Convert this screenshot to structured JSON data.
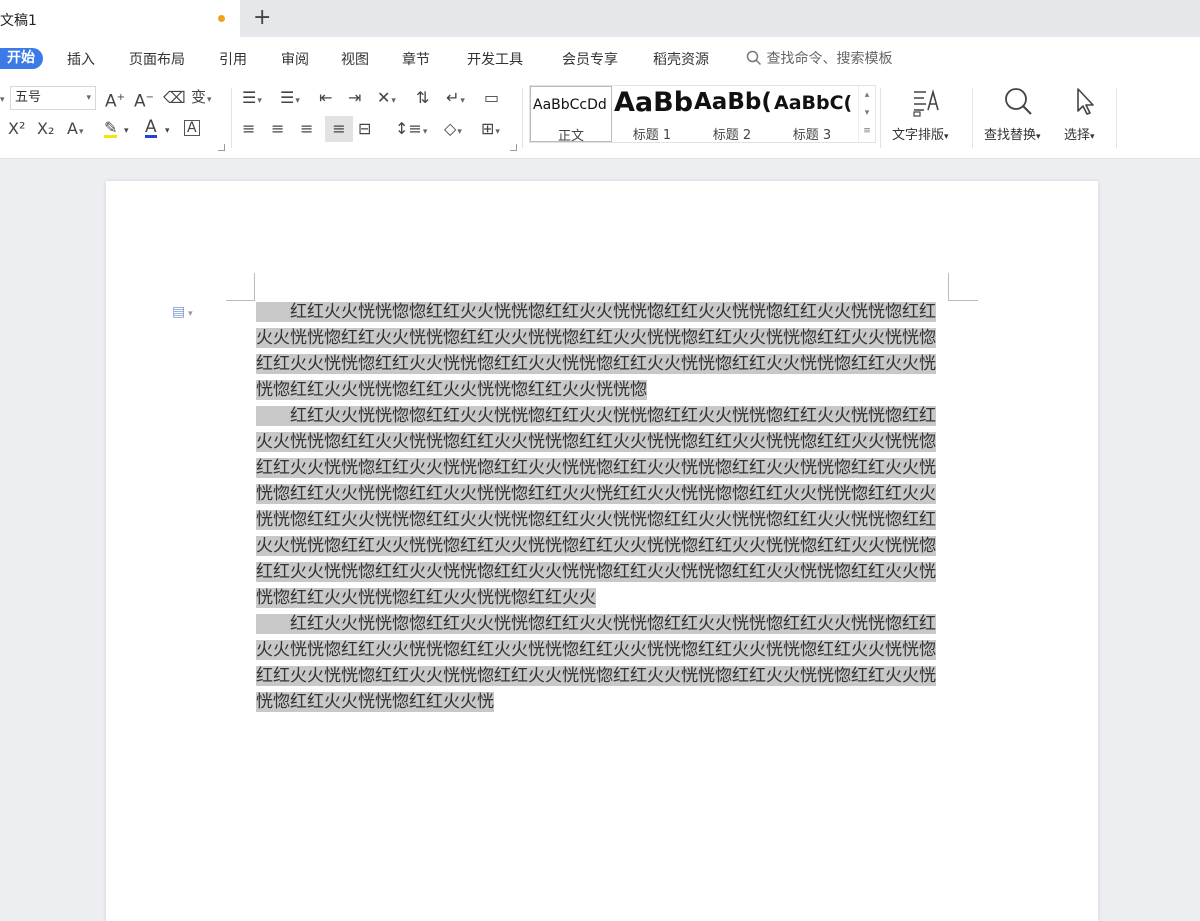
{
  "doc_tab": {
    "title": "文稿1",
    "new_tab": "+"
  },
  "menu": {
    "items": [
      "开始",
      "插入",
      "页面布局",
      "引用",
      "审阅",
      "视图",
      "章节",
      "开发工具",
      "会员专享",
      "稻壳资源"
    ],
    "search_placeholder": "查找命令、搜索模板"
  },
  "ribbon": {
    "font_size": "五号",
    "styles": [
      {
        "sample": "AaBbCcDd",
        "name": "正文"
      },
      {
        "sample": "AaBb",
        "name": "标题 1"
      },
      {
        "sample": "AaBb(",
        "name": "标题 2"
      },
      {
        "sample": "AaBbC(",
        "name": "标题 3"
      }
    ],
    "text_layout": "文字排版",
    "find_replace": "查找替换",
    "select": "选择"
  },
  "document": {
    "paragraphs": [
      "红红火火恍恍惚惚红红火火恍恍惚红红火火恍恍惚红红火火恍恍惚红红火火恍恍惚红红火火恍恍惚红红火火恍恍惚红红火火恍恍惚红红火火恍恍惚红红火火恍恍惚红红火火恍恍惚红红火火恍恍惚红红火火恍恍惚红红火火恍恍惚红红火火恍恍惚红红火火恍恍惚红红火火恍恍惚红红火火恍恍惚红红火火恍恍惚红红火火恍恍惚",
      "红红火火恍恍惚惚红红火火恍恍惚红红火火恍恍惚红红火火恍恍惚红红火火恍恍惚红红火火恍恍惚红红火火恍恍惚红红火火恍恍惚红红火火恍恍惚红红火火恍恍惚红红火火恍恍惚红红火火恍恍惚红红火火恍恍惚红红火火恍恍惚红红火火恍恍惚红红火火恍恍惚红红火火恍恍惚红红火火恍恍惚红红火火恍恍惚红红火火恍红红火火恍恍惚惚红红火火恍恍惚红红火火恍恍惚红红火火恍恍惚红红火火恍恍惚红红火火恍恍惚红红火火恍恍惚红红火火恍恍惚红红火火恍恍惚红红火火恍恍惚红红火火恍恍惚红红火火恍恍惚红红火火恍恍惚红红火火恍恍惚红红火火恍恍惚红红火火恍恍惚红红火火恍恍惚红红火火恍恍惚红红火火恍恍惚红红火火恍恍惚红红火火恍恍惚红红火火恍恍惚红红火火",
      "红红火火恍恍惚惚红红火火恍恍惚红红火火恍恍惚红红火火恍恍惚红红火火恍恍惚红红火火恍恍惚红红火火恍恍惚红红火火恍恍惚红红火火恍恍惚红红火火恍恍惚红红火火恍恍惚红红火火恍恍惚红红火火恍恍惚红红火火恍恍惚红红火火恍恍惚红红火火恍恍惚红红火火恍恍惚红红火火恍恍惚红红火火恍"
    ]
  },
  "colors": {
    "accent": "#3b7be8",
    "selection": "#c8c8c8",
    "unsaved_dot": "#f0a020"
  }
}
